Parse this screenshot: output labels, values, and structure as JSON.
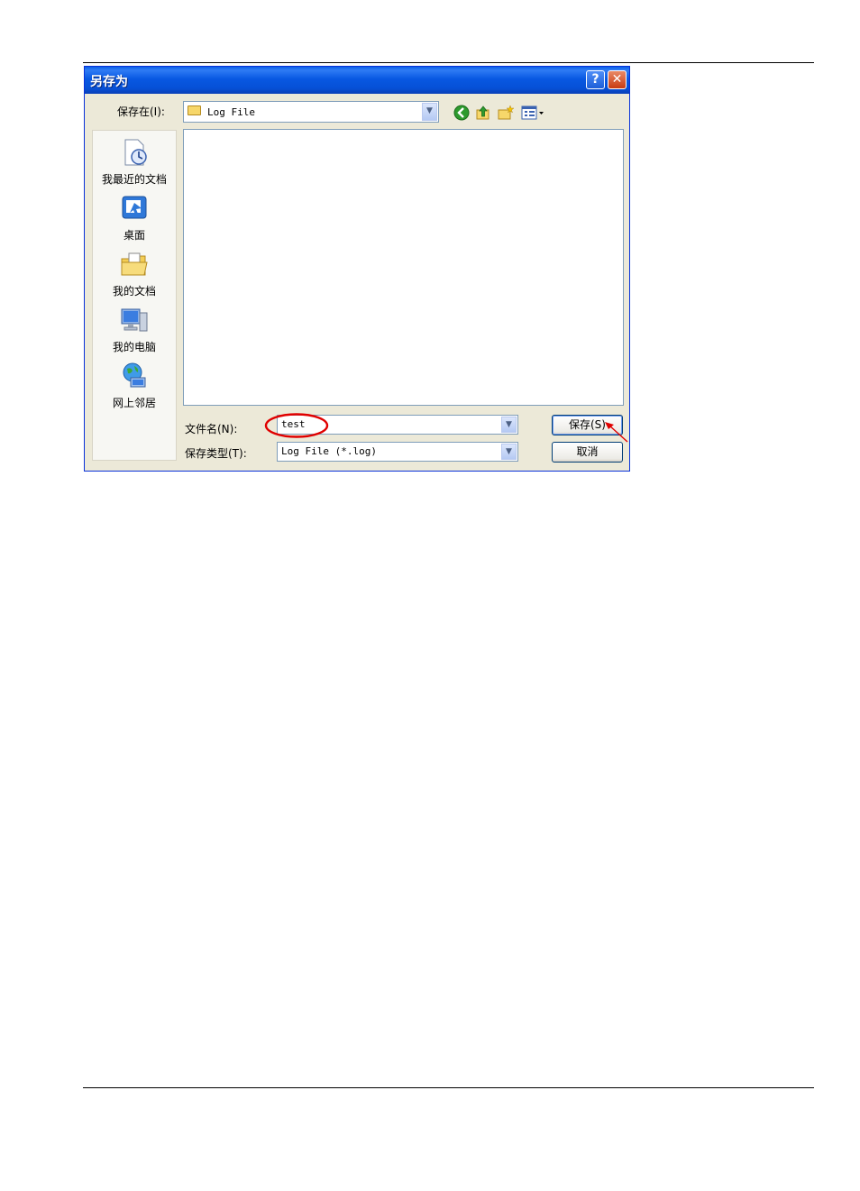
{
  "dialog": {
    "title": "另存为",
    "help_label": "?",
    "close_label": "✕"
  },
  "save_in": {
    "label": "保存在(I):",
    "value": "Log File"
  },
  "toolbar": {
    "icons": [
      "back-icon",
      "up-folder-icon",
      "new-folder-icon",
      "view-menu-icon"
    ]
  },
  "places": [
    {
      "label": "我最近的文档",
      "icon": "recent-documents-icon"
    },
    {
      "label": "桌面",
      "icon": "desktop-icon"
    },
    {
      "label": "我的文档",
      "icon": "my-documents-icon"
    },
    {
      "label": "我的电脑",
      "icon": "my-computer-icon"
    },
    {
      "label": "网上邻居",
      "icon": "network-places-icon"
    }
  ],
  "file_name": {
    "label": "文件名(N):",
    "value": "test"
  },
  "file_type": {
    "label": "保存类型(T):",
    "value": "Log File (*.log)"
  },
  "buttons": {
    "save_label": "保存(S)",
    "cancel_label": "取消"
  },
  "colors": {
    "titlebar": "#0858e2",
    "annotation": "#e00000"
  }
}
